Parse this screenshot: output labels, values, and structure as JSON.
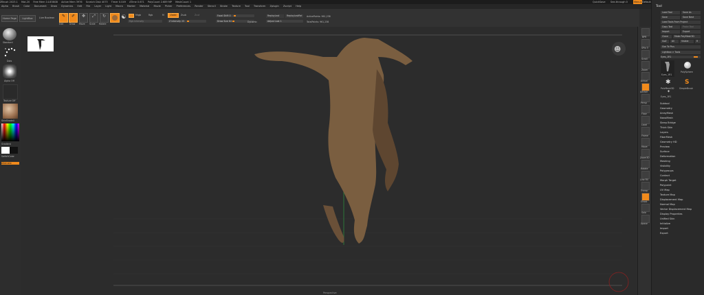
{
  "titlebar": {
    "items": [
      "ZBrush 2023.1",
      "Mot-20",
      "Free Mem 14.838GB",
      "Active Mem 3976",
      "Scratch Disk 4073",
      "Timer 0.049",
      "ATime 0.671",
      "PolyCount 2.689 MP",
      "MeshCount 1"
    ],
    "right": [
      "QuickSave",
      "See-through 0",
      "Menus",
      "DefaultZScript"
    ]
  },
  "menubar": {
    "items": [
      "Alpha",
      "Brush",
      "Color",
      "Document",
      "Draw",
      "Dynamics",
      "Edit",
      "File",
      "Layer",
      "Light",
      "Macro",
      "Marker",
      "Material",
      "Movie",
      "Picker",
      "Preferences",
      "Render",
      "Stencil",
      "Stroke",
      "Texture",
      "Tool",
      "Transform",
      "Zplugin",
      "Zscript",
      "Help"
    ]
  },
  "toolbar": {
    "home_page": "Home Page",
    "lightbox": "LightBox",
    "live_boolean": "Live Boolean",
    "edit": "Edit",
    "draw": "Draw",
    "move": "Move",
    "scale": "Scale",
    "rotate": "Rotate",
    "mrgb": "Mrgb",
    "rgb": "Rgb",
    "m": "M",
    "zadd": "Zadd",
    "zsub": "Zsub",
    "zcut": "Zcut",
    "rgb_intensity": "Rgb Intensity",
    "z_intensity": "Z Intensity 25",
    "focal_shift": "Focal Shift 0",
    "draw_size": "Draw Size 64",
    "dynamic": "Dynamic",
    "replay_last": "ReplayLast",
    "replay_last_rel": "ReplayLastRel",
    "adjust_last": "Adjust Last 1",
    "active_points": "ActivePoints: 961,238",
    "total_points": "TotalPoints: 961,238"
  },
  "leftbar": {
    "brush": "Standard",
    "stroke": "Dots",
    "alpha": "Alpha Off",
    "texture": "Texture Off",
    "material": "SkinShade4",
    "gradient": "Gradient",
    "switch_color": "SwitchColor",
    "alternate": "Alternate"
  },
  "tool_panel": {
    "title": "Tool",
    "buttons": [
      "Load Tool",
      "Save As",
      "Save",
      "Save Next",
      "Load Tools From Project",
      "Copy Tool",
      "Paste Tool",
      "Import",
      "Export",
      "Clone",
      "Make PolyMesh3D",
      "GoZ",
      "All",
      "Visible",
      "R",
      "Lightbox > Tools"
    ],
    "subtool_header": "Goz To Plus",
    "scroll_label": "Eyes_1R1",
    "thumbs": [
      {
        "name": "Eyes_1R1",
        "count": ""
      },
      {
        "name": "PolySphere",
        "count": ""
      },
      {
        "name": "PolyMesh3D",
        "count": "2"
      },
      {
        "name": "SimpleBrush",
        "count": ""
      },
      {
        "name": "Eyes_1R1",
        "count": ""
      }
    ],
    "sections": [
      "Subtool",
      "Geometry",
      "ArrayMesh",
      "NanoMesh",
      "Sleep Bridge",
      "Thick Skin",
      "Layers",
      "FiberMesh",
      "Geometry HD",
      "Preview",
      "Surface",
      "Deformation",
      "Masking",
      "Visibility",
      "Polygroups",
      "Contact",
      "Morph Target",
      "Polypaint",
      "UV Map",
      "Texture Map",
      "Displacement Map",
      "Normal Map",
      "Vector Displacement Map",
      "Display Properties",
      "Unified Skin",
      "Initialize",
      "Import",
      "Export"
    ]
  },
  "shelf": {
    "labels": [
      "BPR",
      "SPix 3",
      "Scroll",
      "Zoom",
      "Actual",
      "AAHalf",
      "Persp",
      "Floor",
      "Local",
      "Frame",
      "Move",
      "Zoom3D",
      "Rotate",
      "Line Fill",
      "Transp",
      "Ghost",
      "Solo",
      "Xpose"
    ]
  },
  "viewport": {
    "bottom_label": "Perspective"
  },
  "colors": {
    "accent": "#f08a1c",
    "panel": "#2a2a2a",
    "viewport": "#2c2c2c",
    "skin": "#8a6e4c"
  }
}
